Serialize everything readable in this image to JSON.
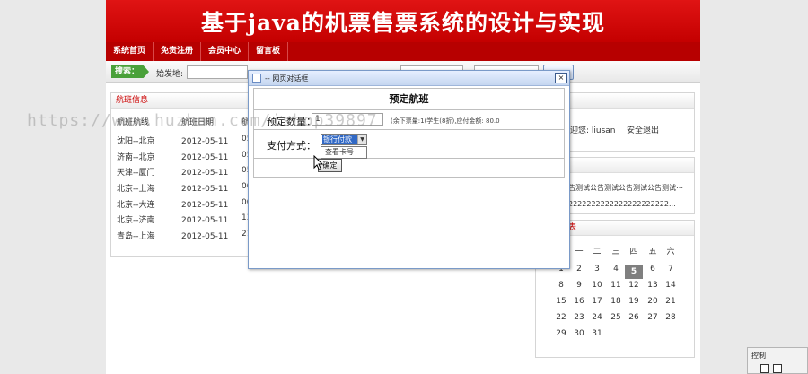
{
  "banner": {
    "title": "基于java的机票售票系统的设计与实现"
  },
  "nav": {
    "items": [
      "系统首页",
      "免责注册",
      "会员中心",
      "留言板"
    ]
  },
  "search": {
    "tag": "搜索：",
    "from_label": "始发地:"
  },
  "flights": {
    "panel_title": "航班信息",
    "columns": [
      "航班航线",
      "航班日期",
      "航"
    ],
    "rows": [
      {
        "route": "沈阳--北京",
        "date": "2012-05-11",
        "extra": "05"
      },
      {
        "route": "济南--北京",
        "date": "2012-05-11",
        "extra": "05"
      },
      {
        "route": "天津--厦门",
        "date": "2012-05-11",
        "extra": "05"
      },
      {
        "route": "北京--上海",
        "date": "2012-05-11",
        "extra": "00"
      },
      {
        "route": "北京--大连",
        "date": "2012-05-11",
        "extra": "00"
      },
      {
        "route": "北京--济南",
        "date": "2012-05-11",
        "extra": "13"
      },
      {
        "route": "青岛--上海",
        "date": "2012-05-11",
        "extra": "21"
      }
    ]
  },
  "user": {
    "welcome": "迎您: liusan",
    "logout": "安全退出"
  },
  "notice": {
    "line1": "告测试公告测试公告测试公告测试⋯",
    "line2": "2222222222222222222222..."
  },
  "calendar": {
    "header_tail": "表",
    "weekdays": [
      "一",
      "二",
      "三",
      "四",
      "五",
      "六"
    ],
    "weeks": [
      [
        "1",
        "2",
        "3",
        "4",
        "5",
        "6",
        "7"
      ],
      [
        "8",
        "9",
        "10",
        "11",
        "12",
        "13",
        "14"
      ],
      [
        "15",
        "16",
        "17",
        "18",
        "19",
        "20",
        "21"
      ],
      [
        "22",
        "23",
        "24",
        "25",
        "26",
        "27",
        "28"
      ],
      [
        "29",
        "30",
        "31"
      ]
    ],
    "today": "5"
  },
  "dialog": {
    "window_title": "-- 网页对话框",
    "close_glyph": "×",
    "heading": "预定航班",
    "qty_label": "预定数量：",
    "qty_value": "1",
    "info": "(余下票量:1(学生(8折),应付金额: 80.0",
    "pay_label": "支付方式：",
    "pay_selected": "银行付款",
    "pay_option": "查看卡号",
    "confirm_label": "确定"
  },
  "watermark": "https://www.huzhan.com/ishop39897",
  "control_panel": {
    "title": "控制"
  },
  "colors": {
    "brand_red": "#c40000",
    "nav_red": "#b70000",
    "search_green": "#4aa13a",
    "select_blue": "#3169c6"
  }
}
